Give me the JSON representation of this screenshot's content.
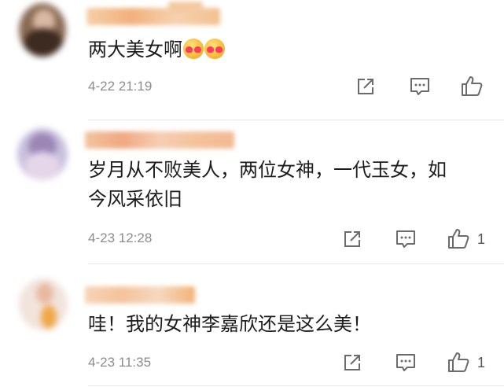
{
  "comments": [
    {
      "text": "两大美女啊",
      "emojis": [
        "hug-emoji",
        "hug-emoji"
      ],
      "time": "4-22 21:19",
      "like_count": ""
    },
    {
      "text": "岁月从不败美人，两位女神，一代玉女，如今风采依旧",
      "time": "4-23 12:28",
      "like_count": "1"
    },
    {
      "text": "哇！我的女神李嘉欣还是这么美！",
      "time": "4-23 11:35",
      "like_count": "1"
    }
  ],
  "icons": {
    "share": "share-icon",
    "reply": "comment-icon",
    "like": "thumbs-up-icon"
  },
  "colors": {
    "text": "#1c1c1c",
    "meta": "#8c8c8c",
    "icon": "#6b6b6b",
    "name_blur": "#f3c08f"
  }
}
